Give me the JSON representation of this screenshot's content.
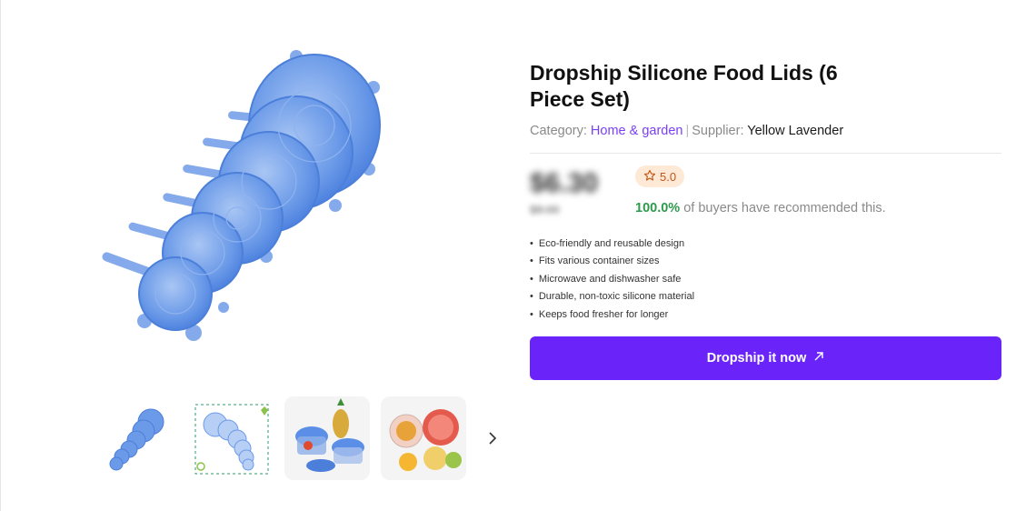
{
  "product": {
    "title": "Dropship Silicone Food Lids (6 Piece Set)",
    "category_label": "Category:",
    "category": "Home & garden",
    "separator": "|",
    "supplier_label": "Supplier:",
    "supplier": "Yellow Lavender",
    "price": "$6.30",
    "old_price": "$8.00",
    "rating": "5.0",
    "recommend_pct": "100.0%",
    "recommend_text": " of buyers have recommended this.",
    "features": [
      "Eco-friendly and reusable design",
      "Fits various container sizes",
      "Microwave and dishwasher safe",
      "Durable, non-toxic silicone material",
      "Keeps food fresher for longer"
    ],
    "cta_label": "Dropship it now",
    "cta_icon": "arrow-up-right-icon"
  },
  "colors": {
    "accent": "#6a24fa",
    "link": "#7b3ff2",
    "success": "#2d9a4b",
    "rating_bg": "#fde9d6",
    "lid_blue": "#5b8ee6"
  },
  "gallery": {
    "thumbnails": [
      "lids-stacked",
      "lids-outline-sketch",
      "lids-on-containers",
      "lids-on-fruit"
    ],
    "next_icon": "chevron-right-icon"
  }
}
